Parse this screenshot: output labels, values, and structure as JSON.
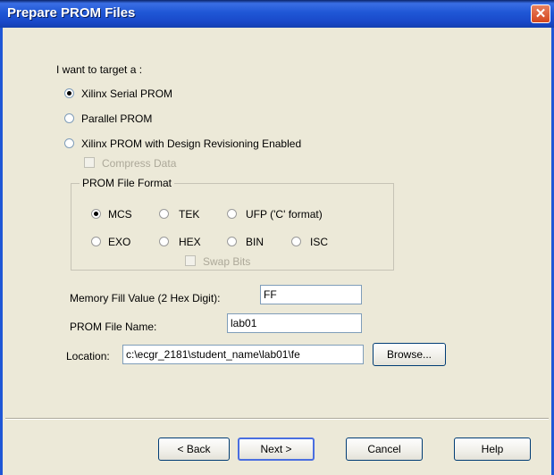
{
  "window": {
    "title": "Prepare PROM Files"
  },
  "target": {
    "label": "I want to target a :",
    "options": [
      {
        "label": "Xilinx Serial PROM",
        "checked": true
      },
      {
        "label": "Parallel PROM",
        "checked": false
      },
      {
        "label": "Xilinx PROM with Design Revisioning Enabled",
        "checked": false
      }
    ],
    "compress_label": "Compress Data"
  },
  "format": {
    "legend": "PROM File Format",
    "options": [
      {
        "label": "MCS",
        "checked": true
      },
      {
        "label": "TEK",
        "checked": false
      },
      {
        "label": "UFP ('C' format)",
        "checked": false
      },
      {
        "label": "EXO",
        "checked": false
      },
      {
        "label": "HEX",
        "checked": false
      },
      {
        "label": "BIN",
        "checked": false
      },
      {
        "label": "ISC",
        "checked": false
      }
    ],
    "swap_label": "Swap Bits"
  },
  "fields": {
    "fill_label": "Memory Fill Value (2 Hex Digit):",
    "fill_value": "FF",
    "name_label": "PROM File Name:",
    "name_value": "lab01",
    "location_label": "Location:",
    "location_value": "c:\\ecgr_2181\\student_name\\lab01\\fe",
    "browse_label": "Browse..."
  },
  "buttons": {
    "back": "< Back",
    "next": "Next >",
    "cancel": "Cancel",
    "help": "Help"
  }
}
